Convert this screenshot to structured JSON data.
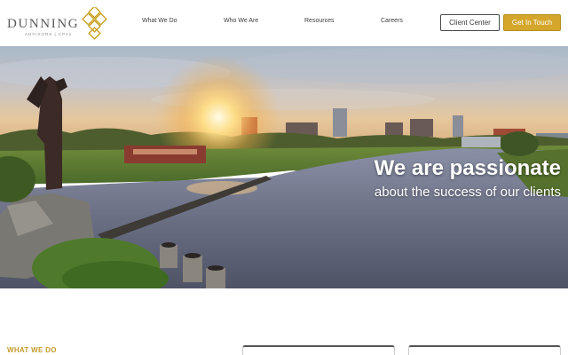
{
  "header": {
    "logo": {
      "name": "DUNNING",
      "tagline": "ADVISORS | CPAs",
      "accent_color": "#c9a227"
    },
    "nav": [
      {
        "label": "What We Do"
      },
      {
        "label": "Who We Are"
      },
      {
        "label": "Resources"
      },
      {
        "label": "Careers"
      }
    ],
    "client_center_label": "Client Center",
    "get_in_touch_label": "Get In Touch",
    "cta_color": "#d4a62b"
  },
  "hero": {
    "headline": "We are passionate",
    "subheadline": "about the success of our clients"
  },
  "section": {
    "label": "WHAT WE DO"
  }
}
